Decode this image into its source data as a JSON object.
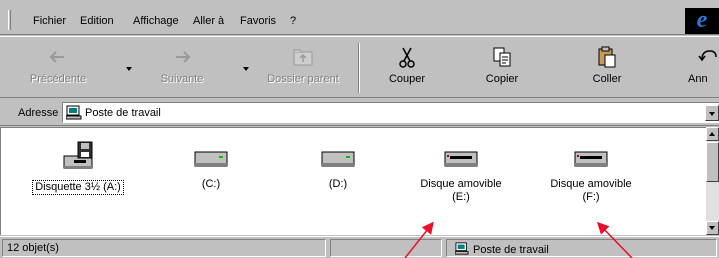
{
  "menu": {
    "items": [
      {
        "label": "Fichier"
      },
      {
        "label": "Edition"
      },
      {
        "label": "Affichage"
      },
      {
        "label": "Aller à"
      },
      {
        "label": "Favoris"
      },
      {
        "label": "?"
      }
    ]
  },
  "toolbar": {
    "back_label": "Précédente",
    "forward_label": "Suivante",
    "parent_label": "Dossier parent",
    "cut_label": "Couper",
    "copy_label": "Copier",
    "paste_label": "Coller",
    "undo_label": "Ann"
  },
  "address": {
    "label": "Adresse",
    "value": "Poste de travail"
  },
  "items": [
    {
      "label": "Disquette 3½ (A:)",
      "line2": "",
      "icon": "floppy-drive-icon"
    },
    {
      "label": "(C:)",
      "line2": "",
      "icon": "hard-drive-icon"
    },
    {
      "label": "(D:)",
      "line2": "",
      "icon": "hard-drive-icon"
    },
    {
      "label": "Disque amovible",
      "line2": "(E:)",
      "icon": "removable-drive-icon"
    },
    {
      "label": "Disque amovible",
      "line2": "(F:)",
      "icon": "removable-drive-icon"
    }
  ],
  "status": {
    "count": "12 objet(s)",
    "location": "Poste de travail"
  },
  "colors": {
    "face": "#c0c0c0",
    "arrow": "#e8102a",
    "ie_blue": "#2a7bd6"
  }
}
